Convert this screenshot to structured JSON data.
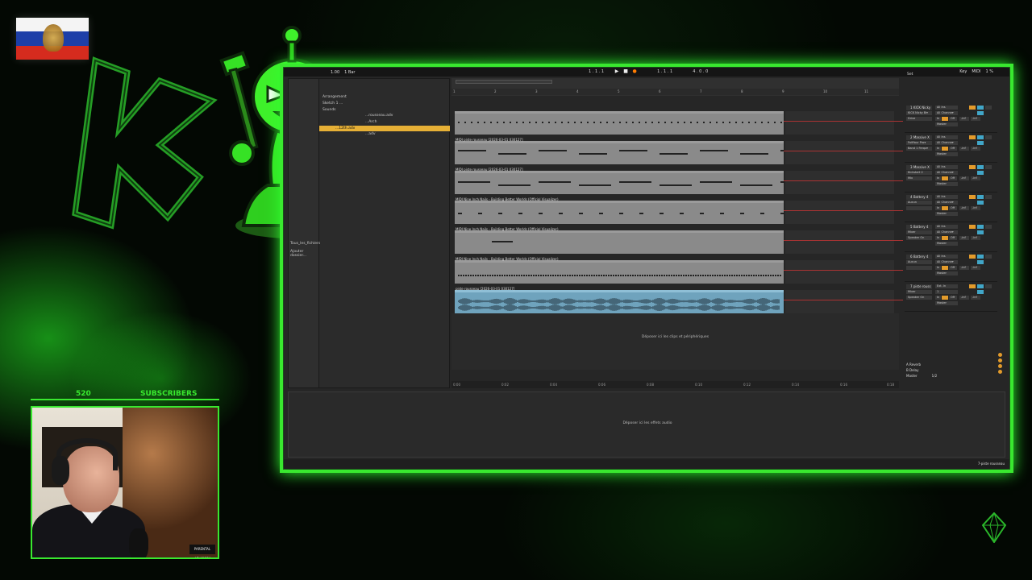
{
  "colors": {
    "accent": "#39e82f",
    "clip_gray": "#8a8a8a",
    "audio_clip": "#6fa3bd",
    "selection": "#e6b036",
    "record_orange": "#ff7b00"
  },
  "daw": {
    "topbar": {
      "tempo": "1.00",
      "signature": "1 Bar",
      "position": "1 . 1 . 1",
      "position2": "1 . 1 . 1",
      "bars": "4 . 0 . 0",
      "key_label": "Key",
      "midi_label": "MIDI",
      "cpu": "1 %"
    },
    "browser": {
      "items": [
        "Arrangement",
        "Sketch 1 ...",
        "Sounds",
        "...rousseau.adv",
        "...Arch",
        "...12th.adv",
        "...adv"
      ],
      "selected": "...12th.adv",
      "footer": [
        "Tous_les_fichiers",
        "Ajouter dossier..."
      ]
    },
    "ruler": [
      "1",
      "2",
      "3",
      "4",
      "5",
      "6",
      "7",
      "8",
      "9",
      "10",
      "11"
    ],
    "tracks": [
      {
        "title": "",
        "type": "midi"
      },
      {
        "title": "MIDI piste rousseau [2026-03-01 030127]",
        "type": "midi"
      },
      {
        "title": "MIDI piste rousseau [2026-03-01 030127]",
        "type": "midi"
      },
      {
        "title": "MIDI Nine Inch Nails - Building Better Worlds (Official Visualizer)",
        "type": "midi"
      },
      {
        "title": "MIDI Nine Inch Nails - Building Better Worlds (Official Visualizer)",
        "type": "midi"
      },
      {
        "title": "MIDI Nine Inch Nails - Building Better Worlds (Official Visualizer)",
        "type": "midi"
      },
      {
        "title": "piste rousseau [2026-03-01 030127]",
        "type": "audio"
      }
    ],
    "drop_clips_text": "Déposer ici les clips et périphériques",
    "timeline": [
      "0:00",
      "0:02",
      "0:04",
      "0:06",
      "0:08",
      "0:10",
      "0:12",
      "0:14",
      "0:16",
      "0:18"
    ],
    "mixer": {
      "set_label": "Set",
      "tracks": [
        {
          "name": "1 KICK Nicky",
          "input": "All Ins",
          "channel": "All Channe▾",
          "device": "KICK Nicky Bi▾",
          "fx": "Drive",
          "out": "Master"
        },
        {
          "name": "2 Massive X",
          "input": "All Ins",
          "channel": "All Channe▾",
          "device": "FaitYour Pro▾",
          "fx": "Band 1 Frequ▾",
          "out": "Master"
        },
        {
          "name": "3 Massive X",
          "input": "All Ins",
          "channel": "All Channe▾",
          "device": "Kickstart 2",
          "fx": "Mix",
          "out": "Master"
        },
        {
          "name": "4 Battery 4",
          "input": "All Ins",
          "channel": "All Channe▾",
          "device": "Aucun",
          "fx": "",
          "out": "Master"
        },
        {
          "name": "5 Battery 4",
          "input": "All Ins",
          "channel": "All Channe▾",
          "device": "Mixer",
          "fx": "Speaker On",
          "out": "Master"
        },
        {
          "name": "6 Battery 4",
          "input": "All Ins",
          "channel": "All Channe▾",
          "device": "Aucun",
          "fx": "",
          "out": "Master"
        },
        {
          "name": "7 piste rouss",
          "input": "Ext. In",
          "channel": "1",
          "device": "Mixer",
          "fx": "Speaker On",
          "out": "Master"
        }
      ],
      "monitor": [
        "In",
        "Auto",
        "Off"
      ],
      "inf": "-inf",
      "returns": [
        {
          "name": "A Reverb"
        },
        {
          "name": "B Delay"
        },
        {
          "name": "Master",
          "value": "1/2"
        }
      ]
    },
    "device_drop_text": "Déposer ici les effets audio",
    "status_right": "7-piste rousseau"
  },
  "overlay": {
    "subscriber_count": "520",
    "subscriber_label": "SUBSCRIBERS",
    "parental": "PARENTAL ADVISORY"
  }
}
